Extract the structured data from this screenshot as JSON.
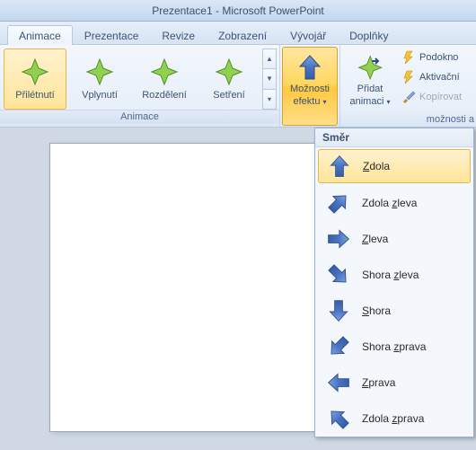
{
  "title": "Prezentace1 - Microsoft PowerPoint",
  "tabs": [
    "Animace",
    "Prezentace",
    "Revize",
    "Zobrazení",
    "Vývojář",
    "Doplňky"
  ],
  "active_tab": 0,
  "animation_group_label": "Animace",
  "gallery": {
    "items": [
      "Přilétnutí",
      "Vplynutí",
      "Rozdělení",
      "Setření"
    ],
    "selected": 0
  },
  "options_button": {
    "line1": "Možnosti",
    "line2": "efektu"
  },
  "add_anim_button": {
    "line1": "Přidat",
    "line2": "animaci"
  },
  "side_cmds": {
    "pane": "Podokno",
    "trigger": "Aktivační",
    "copy": "Kopírovat"
  },
  "sub_label_right": "možnosti a",
  "dropdown": {
    "header": "Směr",
    "items": [
      {
        "label": "Zdola",
        "u": 0,
        "rot": 0
      },
      {
        "label": "Zdola zleva",
        "u": 6,
        "rot": 45
      },
      {
        "label": "Zleva",
        "u": 0,
        "rot": 90
      },
      {
        "label": "Shora zleva",
        "u": 6,
        "rot": 135
      },
      {
        "label": "Shora",
        "u": 0,
        "rot": 180
      },
      {
        "label": "Shora zprava",
        "u": 6,
        "rot": 225
      },
      {
        "label": "Zprava",
        "u": 0,
        "rot": 270
      },
      {
        "label": "Zdola zprava",
        "u": 6,
        "rot": 315
      }
    ],
    "selected": 0
  },
  "colors": {
    "accent": "#ffd65e",
    "ribbon_blue": "#e7effa",
    "arrow_blue": "#4a74c4"
  }
}
